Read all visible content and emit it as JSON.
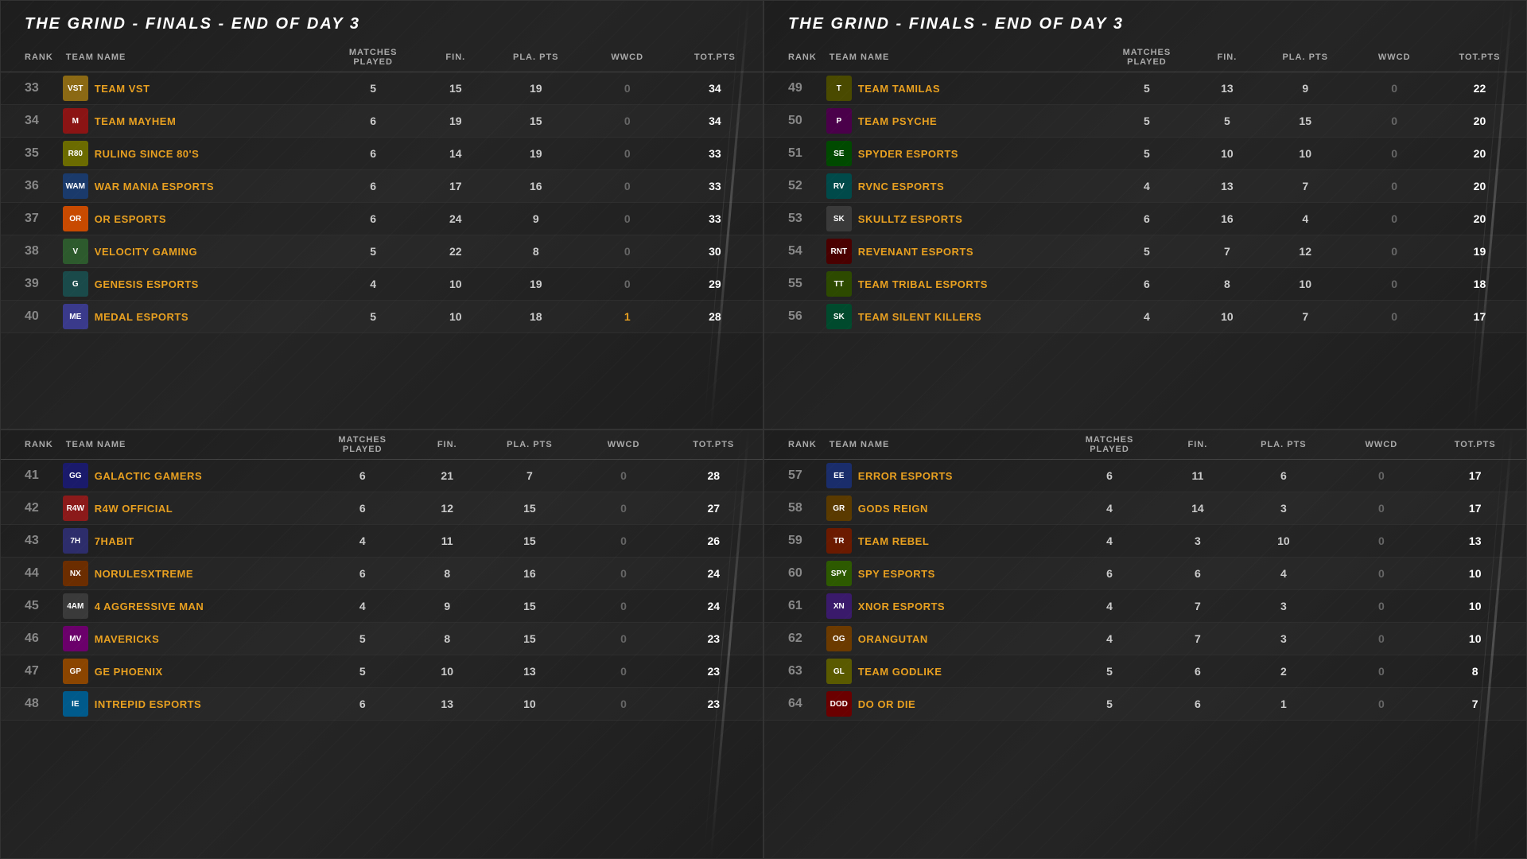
{
  "titles": {
    "left": "THE GRIND - FINALS - END OF DAY 3",
    "right": "THE GRIND - FINALS - END OF DAY 3"
  },
  "columns": {
    "rank": "RANK",
    "teamName": "TEAM NAME",
    "matchesPlayed": "MATCHES PLAYED",
    "fin": "FIN.",
    "plaPts": "PLA. PTS",
    "wwcd": "WWCD",
    "totPts": "TOT.PTS"
  },
  "panels": [
    {
      "id": "top-left",
      "rows": [
        {
          "rank": 33,
          "logo": "VST",
          "logoClass": "logo-vst",
          "name": "TEAM VST",
          "matches": 5,
          "fin": 15,
          "plaPts": 19,
          "wwcd": 0,
          "totPts": 34
        },
        {
          "rank": 34,
          "logo": "M",
          "logoClass": "logo-mayhem",
          "name": "TEAM MAYHEM",
          "matches": 6,
          "fin": 19,
          "plaPts": 15,
          "wwcd": 0,
          "totPts": 34
        },
        {
          "rank": 35,
          "logo": "R80",
          "logoClass": "logo-ruling",
          "name": "RULING SINCE 80'S",
          "matches": 6,
          "fin": 14,
          "plaPts": 19,
          "wwcd": 0,
          "totPts": 33
        },
        {
          "rank": 36,
          "logo": "WAM",
          "logoClass": "logo-wam",
          "name": "WAR MANIA ESPORTS",
          "matches": 6,
          "fin": 17,
          "plaPts": 16,
          "wwcd": 0,
          "totPts": 33
        },
        {
          "rank": 37,
          "logo": "OR",
          "logoClass": "logo-or",
          "name": "OR ESPORTS",
          "matches": 6,
          "fin": 24,
          "plaPts": 9,
          "wwcd": 0,
          "totPts": 33
        },
        {
          "rank": 38,
          "logo": "V",
          "logoClass": "logo-velocity",
          "name": "VELOCITY GAMING",
          "matches": 5,
          "fin": 22,
          "plaPts": 8,
          "wwcd": 0,
          "totPts": 30
        },
        {
          "rank": 39,
          "logo": "G",
          "logoClass": "logo-genesis",
          "name": "GENESIS ESPORTS",
          "matches": 4,
          "fin": 10,
          "plaPts": 19,
          "wwcd": 0,
          "totPts": 29
        },
        {
          "rank": 40,
          "logo": "ME",
          "logoClass": "logo-medal",
          "name": "MEDAL ESPORTS",
          "matches": 5,
          "fin": 10,
          "plaPts": 18,
          "wwcd": 1,
          "totPts": 28
        }
      ]
    },
    {
      "id": "top-right",
      "rows": [
        {
          "rank": 49,
          "logo": "T",
          "logoClass": "logo-tamilas",
          "name": "TEAM TAMILAS",
          "matches": 5,
          "fin": 13,
          "plaPts": 9,
          "wwcd": 0,
          "totPts": 22
        },
        {
          "rank": 50,
          "logo": "P",
          "logoClass": "logo-psyche",
          "name": "TEAM PSYCHE",
          "matches": 5,
          "fin": 5,
          "plaPts": 15,
          "wwcd": 0,
          "totPts": 20
        },
        {
          "rank": 51,
          "logo": "SE",
          "logoClass": "logo-spyder",
          "name": "SPYDER ESPORTS",
          "matches": 5,
          "fin": 10,
          "plaPts": 10,
          "wwcd": 0,
          "totPts": 20
        },
        {
          "rank": 52,
          "logo": "RV",
          "logoClass": "logo-rvnc",
          "name": "RVNC ESPORTS",
          "matches": 4,
          "fin": 13,
          "plaPts": 7,
          "wwcd": 0,
          "totPts": 20
        },
        {
          "rank": 53,
          "logo": "SK",
          "logoClass": "logo-skulltz",
          "name": "SKULLTZ ESPORTS",
          "matches": 6,
          "fin": 16,
          "plaPts": 4,
          "wwcd": 0,
          "totPts": 20
        },
        {
          "rank": 54,
          "logo": "RNT",
          "logoClass": "logo-revenant",
          "name": "REVENANT ESPORTS",
          "matches": 5,
          "fin": 7,
          "plaPts": 12,
          "wwcd": 0,
          "totPts": 19
        },
        {
          "rank": 55,
          "logo": "TT",
          "logoClass": "logo-tribal",
          "name": "TEAM TRIBAL ESPORTS",
          "matches": 6,
          "fin": 8,
          "plaPts": 10,
          "wwcd": 0,
          "totPts": 18
        },
        {
          "rank": 56,
          "logo": "SK",
          "logoClass": "logo-silent",
          "name": "TEAM SILENT KILLERS",
          "matches": 4,
          "fin": 10,
          "plaPts": 7,
          "wwcd": 0,
          "totPts": 17
        }
      ]
    },
    {
      "id": "bottom-left",
      "rows": [
        {
          "rank": 41,
          "logo": "GG",
          "logoClass": "logo-galactic",
          "name": "GALACTIC GAMERS",
          "matches": 6,
          "fin": 21,
          "plaPts": 7,
          "wwcd": 0,
          "totPts": 28
        },
        {
          "rank": 42,
          "logo": "R4W",
          "logoClass": "logo-r4w",
          "name": "R4W OFFICIAL",
          "matches": 6,
          "fin": 12,
          "plaPts": 15,
          "wwcd": 0,
          "totPts": 27
        },
        {
          "rank": 43,
          "logo": "7H",
          "logoClass": "logo-7habit",
          "name": "7HABIT",
          "matches": 4,
          "fin": 11,
          "plaPts": 15,
          "wwcd": 0,
          "totPts": 26
        },
        {
          "rank": 44,
          "logo": "NX",
          "logoClass": "logo-norules",
          "name": "NORULESXTREME",
          "matches": 6,
          "fin": 8,
          "plaPts": 16,
          "wwcd": 0,
          "totPts": 24
        },
        {
          "rank": 45,
          "logo": "4AM",
          "logoClass": "logo-4am",
          "name": "4 AGGRESSIVE MAN",
          "matches": 4,
          "fin": 9,
          "plaPts": 15,
          "wwcd": 0,
          "totPts": 24
        },
        {
          "rank": 46,
          "logo": "MV",
          "logoClass": "logo-mavericks",
          "name": "MAVERICKS",
          "matches": 5,
          "fin": 8,
          "plaPts": 15,
          "wwcd": 0,
          "totPts": 23
        },
        {
          "rank": 47,
          "logo": "GP",
          "logoClass": "logo-gephoenix",
          "name": "GE PHOENIX",
          "matches": 5,
          "fin": 10,
          "plaPts": 13,
          "wwcd": 0,
          "totPts": 23
        },
        {
          "rank": 48,
          "logo": "IE",
          "logoClass": "logo-intrepid",
          "name": "INTREPID ESPORTS",
          "matches": 6,
          "fin": 13,
          "plaPts": 10,
          "wwcd": 0,
          "totPts": 23
        }
      ]
    },
    {
      "id": "bottom-right",
      "rows": [
        {
          "rank": 57,
          "logo": "EE",
          "logoClass": "logo-error",
          "name": "ERROR ESPORTS",
          "matches": 6,
          "fin": 11,
          "plaPts": 6,
          "wwcd": 0,
          "totPts": 17
        },
        {
          "rank": 58,
          "logo": "GR",
          "logoClass": "logo-godsreign",
          "name": "GODS REIGN",
          "matches": 4,
          "fin": 14,
          "plaPts": 3,
          "wwcd": 0,
          "totPts": 17
        },
        {
          "rank": 59,
          "logo": "TR",
          "logoClass": "logo-teamrebel",
          "name": "TEAM REBEL",
          "matches": 4,
          "fin": 3,
          "plaPts": 10,
          "wwcd": 0,
          "totPts": 13
        },
        {
          "rank": 60,
          "logo": "SPY",
          "logoClass": "logo-spy",
          "name": "SPY ESPORTS",
          "matches": 6,
          "fin": 6,
          "plaPts": 4,
          "wwcd": 0,
          "totPts": 10
        },
        {
          "rank": 61,
          "logo": "XN",
          "logoClass": "logo-xnor",
          "name": "XNOR ESPORTS",
          "matches": 4,
          "fin": 7,
          "plaPts": 3,
          "wwcd": 0,
          "totPts": 10
        },
        {
          "rank": 62,
          "logo": "OG",
          "logoClass": "logo-orangutan",
          "name": "ORANGUTAN",
          "matches": 4,
          "fin": 7,
          "plaPts": 3,
          "wwcd": 0,
          "totPts": 10
        },
        {
          "rank": 63,
          "logo": "GL",
          "logoClass": "logo-godlike",
          "name": "TEAM GODLIKE",
          "matches": 5,
          "fin": 6,
          "plaPts": 2,
          "wwcd": 0,
          "totPts": 8
        },
        {
          "rank": 64,
          "logo": "DOD",
          "logoClass": "logo-dod",
          "name": "DO OR DIE",
          "matches": 5,
          "fin": 6,
          "plaPts": 1,
          "wwcd": 0,
          "totPts": 7
        }
      ]
    }
  ]
}
